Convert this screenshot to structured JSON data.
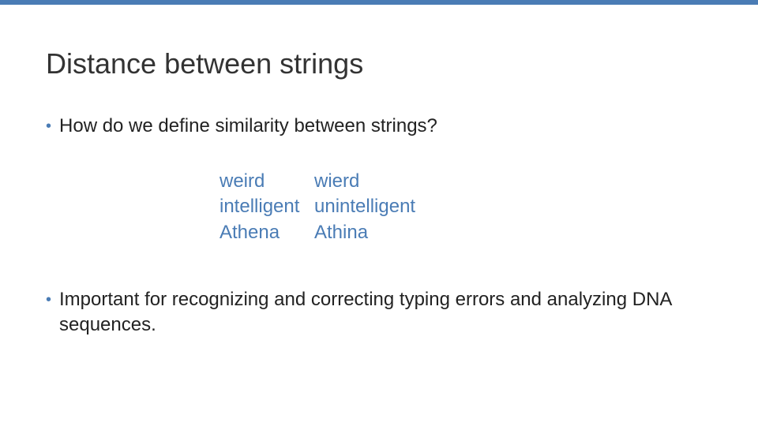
{
  "title": "Distance between strings",
  "bullets": [
    "How do we define similarity between strings?",
    "Important for recognizing and correcting typing errors and analyzing DNA sequences."
  ],
  "pairs": [
    {
      "left": "weird",
      "right": "wierd"
    },
    {
      "left": "intelligent",
      "right": "unintelligent"
    },
    {
      "left": "Athena",
      "right": "Athina"
    }
  ],
  "colors": {
    "accent": "#4a7cb5"
  }
}
